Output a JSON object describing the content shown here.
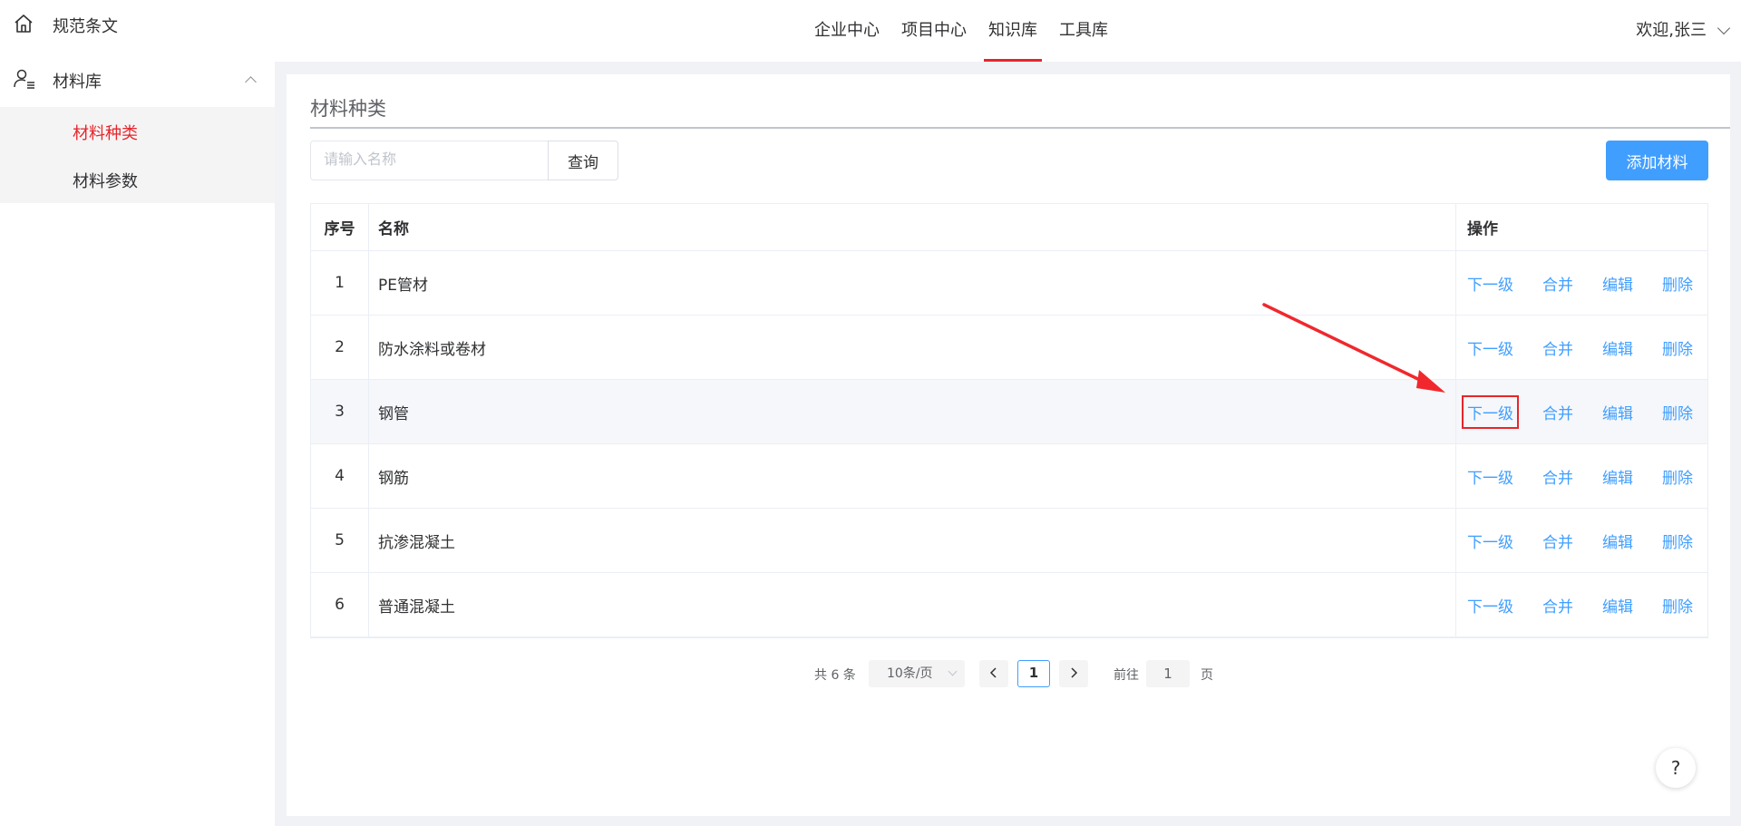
{
  "sidebar": {
    "top_item": {
      "label": "规范条文",
      "icon": "home-icon"
    },
    "group": {
      "label": "材料库",
      "icon": "user-list-icon"
    },
    "sub_items": [
      {
        "label": "材料种类",
        "active": true
      },
      {
        "label": "材料参数",
        "active": false
      }
    ]
  },
  "topnav": {
    "items": [
      {
        "label": "企业中心"
      },
      {
        "label": "项目中心"
      },
      {
        "label": "知识库",
        "active": true
      },
      {
        "label": "工具库"
      }
    ],
    "user_greeting": "欢迎,张三"
  },
  "page": {
    "title": "材料种类",
    "search_placeholder": "请输入名称",
    "query_label": "查询",
    "add_label": "添加材料"
  },
  "table": {
    "headers": {
      "no": "序号",
      "name": "名称",
      "ops": "操作"
    },
    "rows": [
      {
        "no": "1",
        "name": "PE管材"
      },
      {
        "no": "2",
        "name": "防水涂料或卷材"
      },
      {
        "no": "3",
        "name": "钢管"
      },
      {
        "no": "4",
        "name": "钢筋"
      },
      {
        "no": "5",
        "name": "抗渗混凝土"
      },
      {
        "no": "6",
        "name": "普通混凝土"
      }
    ],
    "ops": {
      "sub": "下一级",
      "merge": "合并",
      "edit": "编辑",
      "delete": "删除"
    }
  },
  "pagination": {
    "total": "共 6 条",
    "page_size": "10条/页",
    "current_page": "1",
    "goto_label": "前往",
    "goto_value": "1",
    "page_suffix": "页"
  },
  "help": "?",
  "colors": {
    "accent": "#409eff",
    "active_red": "#e6262c",
    "highlight_box": "#e6262c"
  }
}
